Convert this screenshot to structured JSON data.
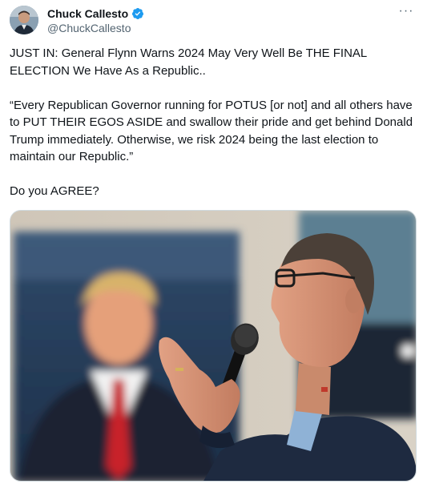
{
  "author": {
    "display_name": "Chuck Callesto",
    "handle": "@ChuckCallesto",
    "verified": true,
    "avatar_icon": "user-avatar"
  },
  "more_icon": "ellipsis-icon",
  "more_label": "···",
  "tweet": {
    "paragraphs": [
      "JUST IN: General Flynn Warns 2024 May Very Well Be THE FINAL ELECTION We Have As a Republic..",
      "“Every Republican Governor running for POTUS [or not] and all others have to PUT THEIR EGOS ASIDE and swallow their pride and get behind Donald Trump immediately. Otherwise, we risk 2024 being the last election to maintain our Republic.”",
      "Do you AGREE?"
    ]
  },
  "colors": {
    "text": "#0f1419",
    "secondary": "#536471",
    "verified": "#1d9bf0",
    "border": "#cfd9de"
  }
}
